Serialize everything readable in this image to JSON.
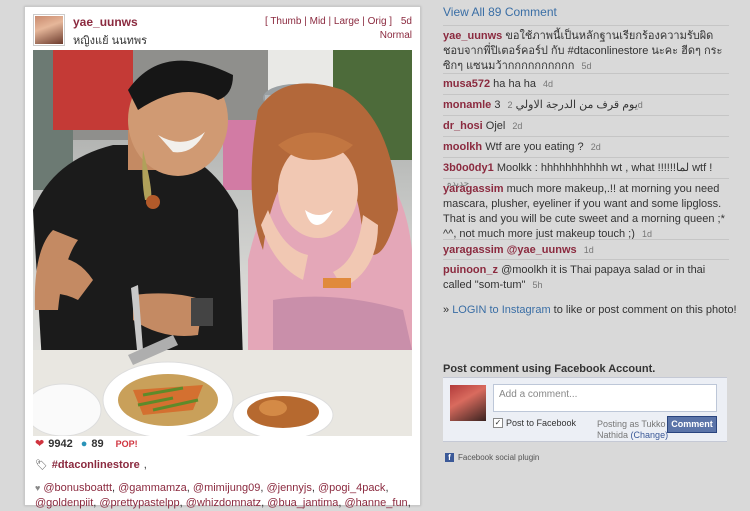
{
  "post": {
    "username": "yae_uunws",
    "fullname": "หญิงแย้ นนทพร",
    "sizes": [
      "Thumb",
      "Mid",
      "Large",
      "Orig"
    ],
    "age": "5d",
    "size_note": "Normal",
    "likes": "9942",
    "comments_count": "89",
    "pop_label": "POP!",
    "tag": "#dtaconlinestore",
    "mentions": [
      "@bonusboattt",
      "@gammamza",
      "@mimijung09",
      "@jennyjs",
      "@pogi_4pack",
      "@goldenpiit",
      "@prettypastelpp",
      "@whizdomnatz",
      "@bua_jantima",
      "@hanne_fun"
    ]
  },
  "comments_panel": {
    "view_all": "View All 89 Comment",
    "comments": [
      {
        "user": "yae_uunws",
        "text": "ขอใช้ภาพนี้เป็นหลักฐานเรียกร้องความรับผิดชอบจากพี่ปิเตอร์คอร์ป กับ #dtaconlinestore นะคะ ฮีดๆ กระซิกๆ แซนมว้ากกกกกกกกกก",
        "age": "5d"
      },
      {
        "user": "musa572",
        "text": "ha ha ha",
        "age": "4d"
      },
      {
        "user": "monamle",
        "text": "3 يوم قرف من الدرجة الاولي",
        "age": "2d"
      },
      {
        "user": "dr_hosi",
        "text": "Ojel",
        "age": "2d"
      },
      {
        "user": "moolkh",
        "text": "Wtf are you eating ?",
        "age": "2d"
      },
      {
        "user": "3b0o0dy1",
        "text": "Moolkk : hhhhhhhhhhh wt , what !!!!!!لما wtf !",
        "age": "جديده"
      },
      {
        "user": "yaragassim",
        "text": "much more makeup,.!! at morning you need mascara, plusher, eyeliner if you want and some lipgloss. That is and you will be cute sweet and a morning queen ;* ^^, not much more just makeup touch ;)",
        "age": "1d"
      },
      {
        "user": "yaragassim",
        "text": "@yae_uunws",
        "age": "1d"
      },
      {
        "user": "puinoon_z",
        "text": "@moolkh it is Thai papaya salad or in thai called \"som-tum\"",
        "age": "5h"
      }
    ],
    "login_prefix": "» ",
    "login_link": "LOGIN to Instagram",
    "login_suffix": " to like or post comment on this photo!"
  },
  "facebook": {
    "title": "Post comment using Facebook Account.",
    "placeholder": "Add a comment...",
    "post_to_fb": "Post to Facebook",
    "posting_as": "Posting as Tukko Nathida",
    "change": "(Change)",
    "button": "Comment",
    "plugin": "Facebook social plugin"
  },
  "colors": {
    "link": "#8b2a3f",
    "blue": "#3a6ea5",
    "fb": "#3b5998",
    "heart": "#d0343f",
    "bubble": "#2a93b8"
  },
  "icons": [
    "heart-icon",
    "comment-bubble-icon",
    "tag-icon",
    "facebook-icon",
    "checkbox-icon"
  ]
}
